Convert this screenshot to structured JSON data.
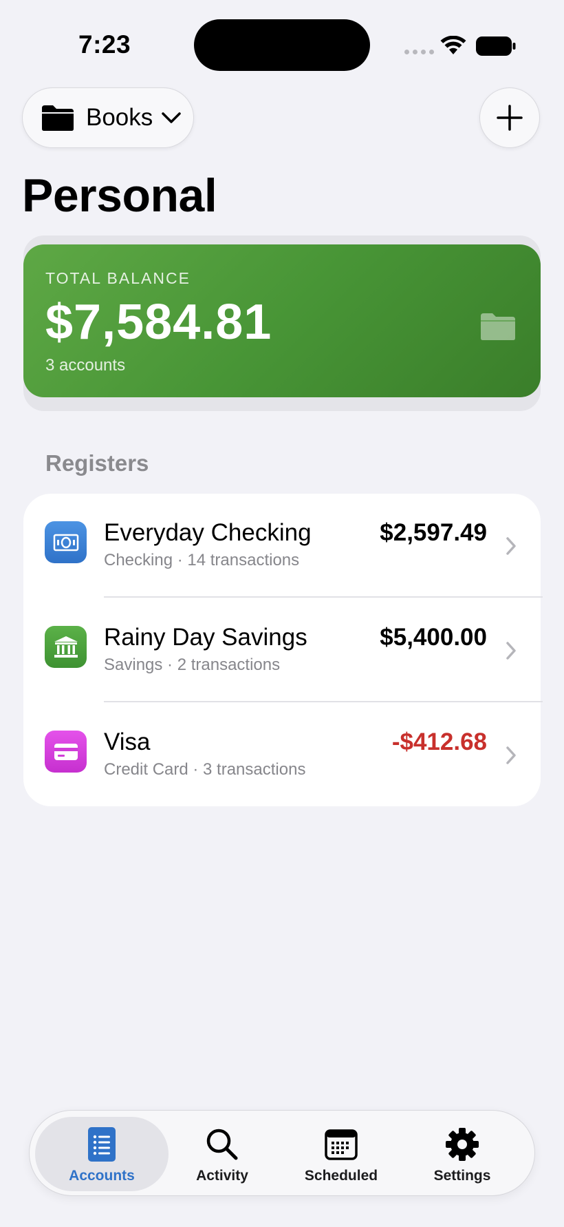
{
  "status_bar": {
    "time": "7:23"
  },
  "header": {
    "book_selector_label": "Books",
    "title": "Personal"
  },
  "balance_card": {
    "caption": "TOTAL BALANCE",
    "amount": "$7,584.81",
    "subtitle": "3 accounts",
    "color": "#4a9838"
  },
  "registers": {
    "section_title": "Registers",
    "items": [
      {
        "name": "Everyday Checking",
        "meta": "Checking · 14 transactions",
        "amount": "$2,597.49",
        "icon": "banknote-icon",
        "icon_color": "#3a82d6",
        "negative": false
      },
      {
        "name": "Rainy Day Savings",
        "meta": "Savings · 2 transactions",
        "amount": "$5,400.00",
        "icon": "bank-building-icon",
        "icon_color": "#4ea43e",
        "negative": false
      },
      {
        "name": "Visa",
        "meta": "Credit Card · 3 transactions",
        "amount": "-$412.68",
        "icon": "credit-card-icon",
        "icon_color": "#d13ed8",
        "negative": true
      }
    ]
  },
  "colors": {
    "negative": "#c8302c",
    "accent": "#2f72c8"
  },
  "tabs": [
    {
      "label": "Accounts",
      "icon": "list-icon",
      "active": true
    },
    {
      "label": "Activity",
      "icon": "search-icon",
      "active": false
    },
    {
      "label": "Scheduled",
      "icon": "calendar-icon",
      "active": false
    },
    {
      "label": "Settings",
      "icon": "gear-icon",
      "active": false
    }
  ]
}
